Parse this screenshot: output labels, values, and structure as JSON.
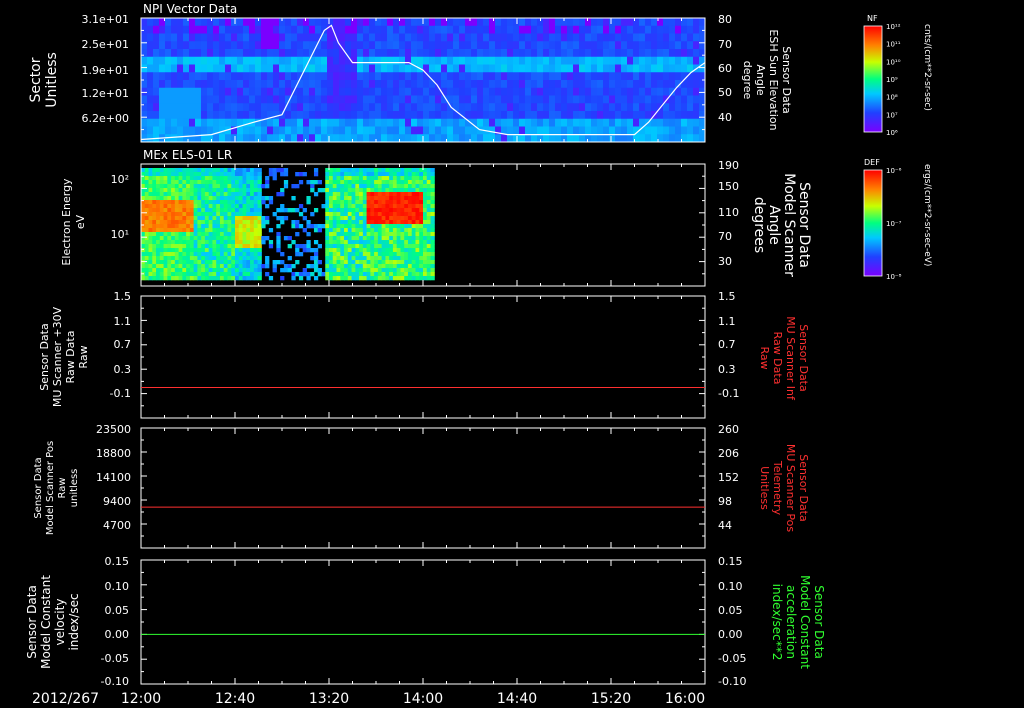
{
  "date_label": "2012/267",
  "time_ticks": [
    "12:00",
    "12:40",
    "13:20",
    "14:00",
    "14:40",
    "15:20",
    "16:00"
  ],
  "chart_data": [
    {
      "type": "heatmap",
      "title": "NPI Vector Data",
      "ylabel": [
        "Sector",
        "Unitless"
      ],
      "y_ticks": [
        "3.1e+01",
        "2.5e+01",
        "1.9e+01",
        "1.2e+01",
        "6.2e+00"
      ],
      "overlay_line": {
        "ylabel": [
          "Sensor Data",
          "ESH Sun Elevation",
          "Angle",
          "degree"
        ],
        "y_ticks": [
          "80",
          "70",
          "60",
          "50",
          "40"
        ],
        "ylim": [
          30,
          80
        ],
        "x_hours": [
          0.0,
          0.5,
          0.8,
          1.0,
          1.15,
          1.3,
          1.35,
          1.4,
          1.5,
          1.6,
          1.75,
          1.9,
          2.0,
          2.1,
          2.2,
          2.4,
          2.6,
          3.0,
          3.2,
          3.35,
          3.5,
          3.6,
          3.7,
          3.8,
          3.9,
          4.0
        ],
        "values": [
          31,
          33,
          38,
          41,
          58,
          75,
          77,
          70,
          62,
          62,
          62,
          62,
          59,
          53,
          44,
          35,
          33,
          33,
          33,
          33,
          33,
          38,
          45,
          52,
          58,
          62
        ]
      },
      "colorbar": {
        "label": "NF",
        "units": "cnts/(cm**2-sr-sec)",
        "ticks": [
          "10¹²",
          "10¹¹",
          "10¹⁰",
          "10⁹",
          "10⁸",
          "10⁷",
          "10⁶"
        ]
      }
    },
    {
      "type": "heatmap",
      "title": "MEx ELS-01 LR",
      "ylabel": [
        "Electron Energy",
        "eV"
      ],
      "y_ticks": [
        "10²",
        "10¹"
      ],
      "overlay_line": {
        "ylabel": [
          "Sensor Data",
          "Model Scanner",
          "Angle",
          "degrees"
        ],
        "y_ticks": [
          "190",
          "150",
          "110",
          "70",
          "30"
        ],
        "ylim": [
          10,
          190
        ],
        "x_hours": [
          0.0,
          4.0
        ],
        "values": [
          10,
          10
        ]
      },
      "colorbar": {
        "label": "DEF",
        "units": "ergs/(cm**2-sr-sec-eV)",
        "ticks": [
          "10⁻⁶",
          "10⁻⁷",
          "10⁻⁸"
        ]
      }
    },
    {
      "type": "line",
      "ylabel": [
        "Sensor Data",
        "MU Scanner +30V",
        "Raw Data",
        "Raw"
      ],
      "y_ticks": [
        "1.5",
        "1.1",
        "0.7",
        "0.3",
        "-0.1"
      ],
      "ylim": [
        -0.5,
        1.5
      ],
      "right_ylabel": [
        "Sensor Data",
        "MU Scanner Inf",
        "Raw Data",
        "Raw"
      ],
      "right_y_ticks": [
        "1.5",
        "1.1",
        "0.7",
        "0.3",
        "-0.1"
      ],
      "series": [
        {
          "color": "#ff3030",
          "x_hours": [
            0.0,
            4.0
          ],
          "values": [
            0.0,
            0.0
          ]
        }
      ]
    },
    {
      "type": "line",
      "ylabel": [
        "Sensor Data",
        "Model Scanner Pos",
        "Raw",
        "unitless"
      ],
      "y_ticks": [
        "23500",
        "18800",
        "14100",
        "9400",
        "4700"
      ],
      "ylim": [
        0,
        23500
      ],
      "right_ylabel": [
        "Sensor Data",
        "MU Scanner Pos",
        "Telemetry",
        "Unitless"
      ],
      "right_y_ticks": [
        "260",
        "206",
        "152",
        "98",
        "44"
      ],
      "series": [
        {
          "color": "#ff3030",
          "x_hours": [
            0.0,
            4.0
          ],
          "values": [
            8000,
            8000
          ]
        }
      ]
    },
    {
      "type": "line",
      "ylabel": [
        "Sensor Data",
        "Model Constant",
        "velocity",
        "index/sec"
      ],
      "y_ticks": [
        "0.15",
        "0.10",
        "0.05",
        "0.00",
        "-0.05",
        "-0.10"
      ],
      "ylim": [
        -0.1,
        0.15
      ],
      "right_ylabel": [
        "Sensor Data",
        "Model Constant",
        "acceleration",
        "index/sec**2"
      ],
      "right_y_ticks": [
        "0.15",
        "0.10",
        "0.05",
        "0.00",
        "-0.05",
        "-0.10"
      ],
      "series": [
        {
          "color": "#30ff30",
          "x_hours": [
            0.0,
            4.0
          ],
          "values": [
            0.0,
            0.0
          ]
        }
      ]
    }
  ]
}
